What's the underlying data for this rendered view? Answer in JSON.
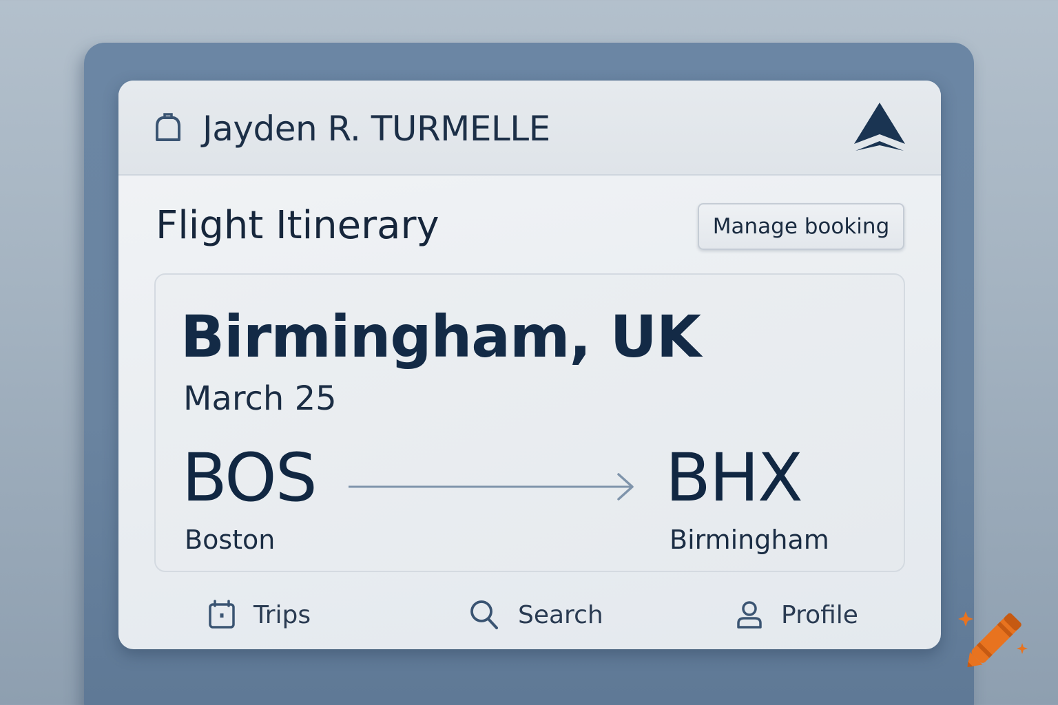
{
  "header": {
    "passenger_name": "Jayden R. TURMELLE",
    "leading_icon": "bag-icon",
    "logo_icon": "airline-logo-icon"
  },
  "itinerary": {
    "title": "Flight Itinerary",
    "manage_label": "Manage booking"
  },
  "flight": {
    "destination": "Birmingham, UK",
    "date": "March 25",
    "origin_code": "BOS",
    "origin_city": "Boston",
    "dest_code": "BHX",
    "dest_city": "Birmingham",
    "route_icon": "arrow-right-icon"
  },
  "nav": {
    "items": [
      {
        "label": "Trips",
        "icon": "trips-icon"
      },
      {
        "label": "Search",
        "icon": "search-icon"
      },
      {
        "label": "Profile",
        "icon": "profile-icon"
      }
    ]
  },
  "colors": {
    "ink": "#132a46",
    "panel": "#6b86a4",
    "card": "#eceff2",
    "accent_orange": "#e8731f"
  }
}
